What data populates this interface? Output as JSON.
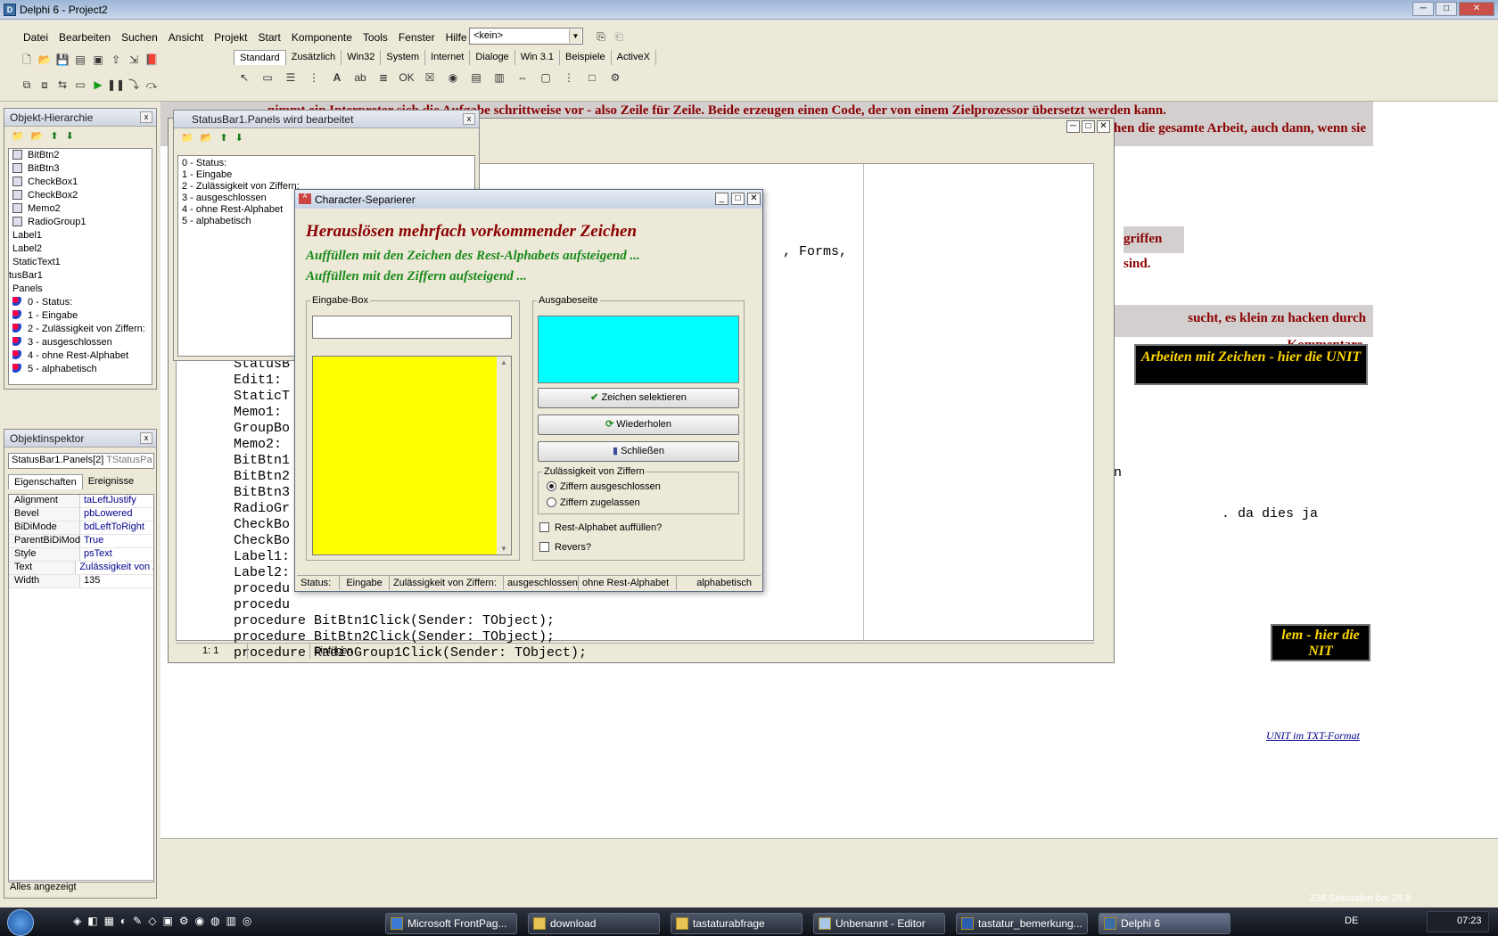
{
  "window": {
    "title": "Delphi 6 - Project2",
    "tray_text": "238 Sekunden bei 28.8"
  },
  "menu": [
    "Datei",
    "Bearbeiten",
    "Suchen",
    "Ansicht",
    "Projekt",
    "Start",
    "Komponente",
    "Tools",
    "Fenster",
    "Hilfe"
  ],
  "toolbar": {
    "combo_value": "<kein>"
  },
  "palette_tabs": [
    "Standard",
    "Zusätzlich",
    "Win32",
    "System",
    "Internet",
    "Dialoge",
    "Win 3.1",
    "Beispiele",
    "ActiveX"
  ],
  "hierarchy": {
    "title": "Objekt-Hierarchie",
    "items": [
      "BitBtn2",
      "BitBtn3",
      "CheckBox1",
      "CheckBox2",
      "Memo2",
      "RadioGroup1",
      "Label1",
      "Label2",
      "StaticText1",
      "tusBar1",
      "Panels",
      "0 - Status:",
      "1 - Eingabe",
      "2 - Zulässigkeit von Ziffern:",
      "3 - ausgeschlossen",
      "4 - ohne Rest-Alphabet",
      "5 - alphabetisch"
    ]
  },
  "panels_editor": {
    "title": "StatusBar1.Panels wird bearbeitet",
    "items": [
      "0 - Status:",
      "1 - Eingabe",
      "2 - Zulässigkeit von Ziffern:",
      "3 - ausgeschlossen",
      "4 - ohne Rest-Alphabet",
      "5 - alphabetisch"
    ]
  },
  "inspector": {
    "title": "Objektinspektor",
    "object": "StatusBar1.Panels[2]",
    "object_type": "TStatusPa",
    "tab_props": "Eigenschaften",
    "tab_events": "Ereignisse",
    "rows": [
      {
        "k": "Alignment",
        "v": "taLeftJustify"
      },
      {
        "k": "Bevel",
        "v": "pbLowered"
      },
      {
        "k": "BiDiMode",
        "v": "bdLeftToRight"
      },
      {
        "k": "ParentBiDiMod",
        "v": "True"
      },
      {
        "k": "Style",
        "v": "psText"
      },
      {
        "k": "Text",
        "v": "Zulässigkeit von Z"
      },
      {
        "k": "Width",
        "v": "135"
      }
    ],
    "footer": "Alles angezeigt"
  },
  "webpage": {
    "line1": "nimmt ein Interpreter sich die Aufgabe schrittweise vor - also Zeile für Zeile. Beide erzeugen einen Code, der von einem Zielprozessor übersetzt werden kann.",
    "line2": "mit der gleichen die gesamte Arbeit, auch dann, wenn sie",
    "line3": "griffen sind.",
    "line4": "sucht, es klein zu hacken durch Kommentare.",
    "box1": "Arbeiten mit Zeichen - hier die UNIT",
    "box2": "lem - hier die NIT",
    "link": "UNIT im TXT-Format",
    "code_right1": "en",
    "code_right2": ". da dies ja"
  },
  "editor": {
    "code": [
      "StatusB",
      "Edit1:",
      "StaticT",
      "Memo1:",
      "GroupBo",
      "Memo2:",
      "BitBtn1",
      "BitBtn2",
      "BitBtn3",
      "RadioGr",
      "CheckBo",
      "CheckBo",
      "Label1:",
      "Label2:",
      "procedu",
      "procedu",
      "procedure BitBtn1Click(Sender: TObject);",
      "procedure BitBtn2Click(Sender: TObject);",
      "procedure RadioGroup1Click(Sender: TObject);"
    ],
    "forms_fragment": ", Forms,",
    "status_pos": "1:   1",
    "status_mode": "Einfügen"
  },
  "dialog": {
    "title": "Character-Separierer",
    "heading": "Herauslösen mehrfach vorkommender Zeichen",
    "line1": "Auffüllen mit den Zeichen des Rest-Alphabets aufsteigend ...",
    "line2": "Auffüllen mit den Ziffern aufsteigend ...",
    "input_group": "Eingabe-Box",
    "output_group": "Ausgabeseite",
    "btn_select": "Zeichen selektieren",
    "btn_repeat": "Wiederholen",
    "btn_close": "Schließen",
    "radio_group": "Zulässigkeit von Ziffern",
    "radio1": "Ziffern ausgeschlossen",
    "radio2": "Ziffern zugelassen",
    "check1": "Rest-Alphabet auffüllen?",
    "check2": "Revers?",
    "status": [
      "Status:",
      "Eingabe",
      "Zulässigkeit von Ziffern:",
      "ausgeschlossen",
      "ohne Rest-Alphabet",
      "alphabetisch"
    ],
    "colors": {
      "memo": "#ffff00",
      "output": "#00ffff"
    }
  },
  "taskbar": {
    "items": [
      "Microsoft FrontPag...",
      "download",
      "tastaturabfrage",
      "Unbenannt - Editor",
      "tastatur_bemerkung...",
      "Delphi 6"
    ],
    "lang": "DE",
    "time": "07:23"
  }
}
